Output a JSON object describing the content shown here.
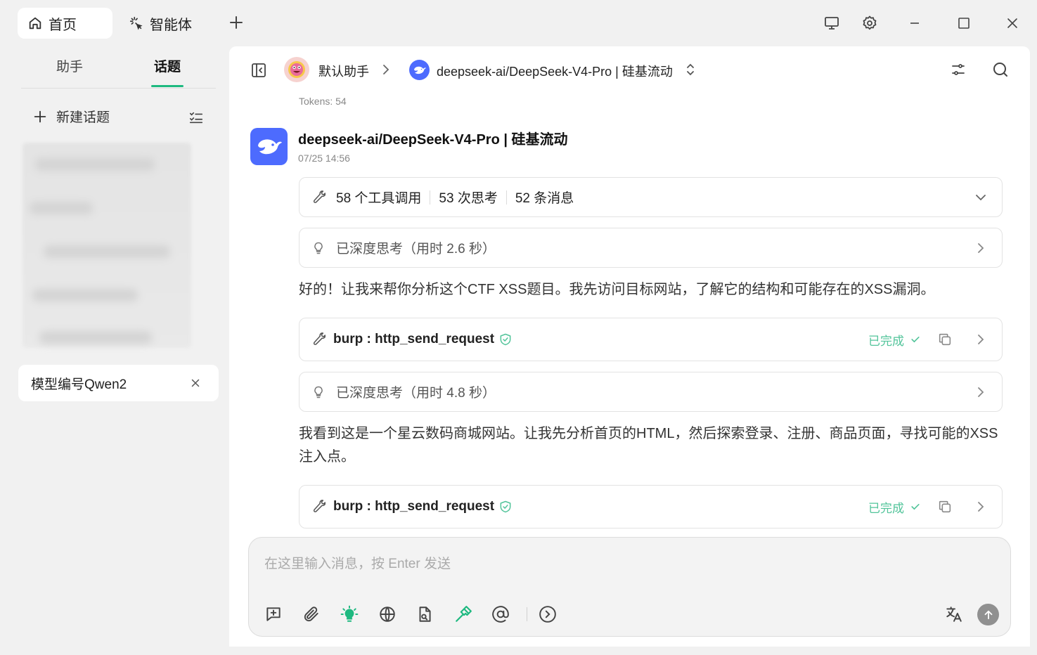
{
  "titlebar": {
    "tabs": [
      {
        "label": "首页",
        "icon": "home-icon"
      },
      {
        "label": "智能体",
        "icon": "sparkle-icon"
      }
    ]
  },
  "sidebar": {
    "tabs": [
      {
        "label": "助手",
        "active": false
      },
      {
        "label": "话题",
        "active": true
      }
    ],
    "new_topic_label": "新建话题",
    "active_topic": "模型编号Qwen2"
  },
  "header": {
    "assistant_name": "默认助手",
    "model_name": "deepseek-ai/DeepSeek-V4-Pro | 硅基流动"
  },
  "chat": {
    "tokens": "Tokens: 54",
    "message": {
      "model": "deepseek-ai/DeepSeek-V4-Pro | 硅基流动",
      "time": "07/25 14:56",
      "summary": {
        "tool_calls": "58 个工具调用",
        "thinking": "53 次思考",
        "messages": "52 条消息"
      },
      "think1": "已深度思考（用时 2.6 秒）",
      "para1": "好的！让我来帮你分析这个CTF XSS题目。我先访问目标网站，了解它的结构和可能存在的XSS漏洞。",
      "tool1": {
        "name": "burp : http_send_request",
        "status": "已完成"
      },
      "think2": "已深度思考（用时 4.8 秒）",
      "para2": "我看到这是一个星云数码商城网站。让我先分析首页的HTML，然后探索登录、注册、商品页面，寻找可能的XSS注入点。",
      "tool2": {
        "name": "burp : http_send_request",
        "status": "已完成"
      }
    }
  },
  "input": {
    "placeholder": "在这里输入消息，按 Enter 发送"
  },
  "colors": {
    "accent": "#1eb980",
    "done": "#52c49a",
    "deepseek": "#4d6bfe"
  }
}
